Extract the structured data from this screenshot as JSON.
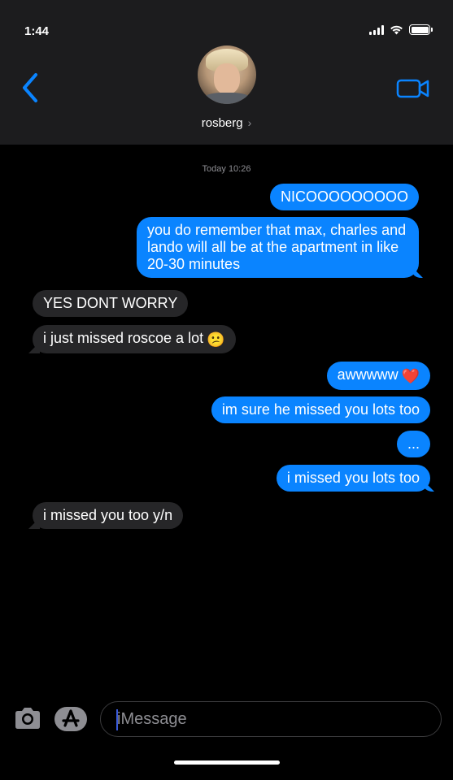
{
  "status_bar": {
    "time": "1:44"
  },
  "header": {
    "contact_name": "rosberg",
    "chevron": "›",
    "back_icon": "chevron-left-icon",
    "video_icon": "video-camera-icon"
  },
  "conversation": {
    "timestamp": "Today 10:26",
    "messages": [
      {
        "from": "me",
        "text": "NICOOOOOOOOO"
      },
      {
        "from": "me",
        "text": "you do remember that max, charles and lando will all be at the apartment in like 20-30 minutes"
      },
      {
        "from": "them",
        "text": "YES DONT WORRY"
      },
      {
        "from": "them",
        "text": "i just missed roscoe a lot",
        "emoji": "😕"
      },
      {
        "from": "me",
        "text": "awwwww",
        "emoji": "❤️"
      },
      {
        "from": "me",
        "text": "im sure he missed you lots too"
      },
      {
        "from": "me",
        "text": "..."
      },
      {
        "from": "me",
        "text": "i missed you lots too"
      },
      {
        "from": "them",
        "text": "i missed you too y/n"
      }
    ]
  },
  "composer": {
    "placeholder": "iMessage",
    "camera_icon": "camera-icon",
    "apps_icon": "app-store-icon"
  },
  "colors": {
    "sent_bubble": "#0a84ff",
    "received_bubble": "#262628",
    "header_bg": "#1c1c1e",
    "accent": "#0a84ff"
  }
}
